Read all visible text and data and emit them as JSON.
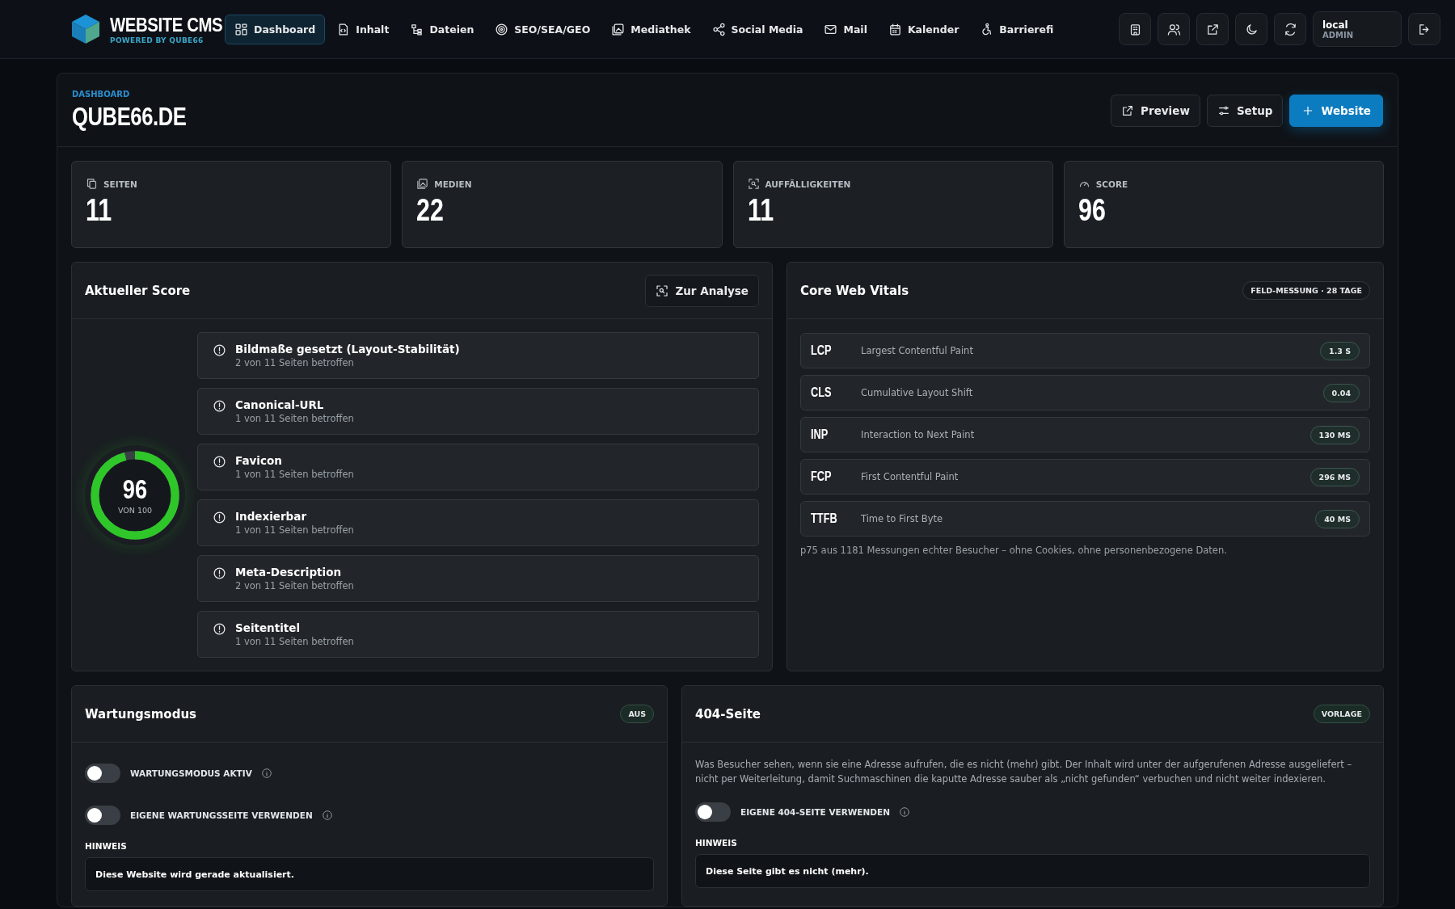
{
  "nav": {
    "logo_title": "WEBSITE CMS",
    "logo_subtitle": "POWERED BY QUBE66",
    "items": [
      {
        "label": "Dashboard",
        "selected": true
      },
      {
        "label": "Inhalt",
        "selected": false
      },
      {
        "label": "Dateien",
        "selected": false
      },
      {
        "label": "SEO/SEA/GEO",
        "selected": false
      },
      {
        "label": "Mediathek",
        "selected": false
      },
      {
        "label": "Social Media",
        "selected": false
      },
      {
        "label": "Mail",
        "selected": false
      },
      {
        "label": "Kalender",
        "selected": false
      },
      {
        "label": "Barrierefi",
        "selected": false
      }
    ],
    "user": {
      "name": "local",
      "role": "ADMIN"
    }
  },
  "header": {
    "breadcrumb": "DASHBOARD",
    "title": "QUBE66.DE",
    "buttons": [
      {
        "label": "Preview",
        "kind": "external"
      },
      {
        "label": "Setup",
        "kind": "settings"
      },
      {
        "label": "Website",
        "kind": "add"
      }
    ]
  },
  "stats": [
    {
      "label": "SEITEN",
      "value": "11"
    },
    {
      "label": "MEDIEN",
      "value": "22"
    },
    {
      "label": "AUFFÄLLIGKEITEN",
      "value": "11"
    },
    {
      "label": "SCORE",
      "value": "96"
    }
  ],
  "score_panel": {
    "title": "Aktueller Score",
    "button": "Zur Analyse",
    "score": "96",
    "caption": "VON 100",
    "level": 0.96,
    "issues": [
      {
        "title": "Bildmaße gesetzt (Layout-Stabilität)",
        "detail": "2 von 11 Seiten betroffen"
      },
      {
        "title": "Canonical-URL",
        "detail": "1 von 11 Seiten betroffen"
      },
      {
        "title": "Favicon",
        "detail": "1 von 11 Seiten betroffen"
      },
      {
        "title": "Indexierbar",
        "detail": "1 von 11 Seiten betroffen"
      },
      {
        "title": "Meta-Description",
        "detail": "2 von 11 Seiten betroffen"
      },
      {
        "title": "Seitentitel",
        "detail": "1 von 11 Seiten betroffen"
      }
    ]
  },
  "web_vitals": {
    "title": "Core Web Vitals",
    "badge": "FELD-MESSUNG · 28 TAGE",
    "metrics": [
      {
        "code": "LCP",
        "name": "Largest Contentful Paint",
        "value": "1.3 S"
      },
      {
        "code": "CLS",
        "name": "Cumulative Layout Shift",
        "value": "0.04"
      },
      {
        "code": "INP",
        "name": "Interaction to Next Paint",
        "value": "130 MS"
      },
      {
        "code": "FCP",
        "name": "First Contentful Paint",
        "value": "296 MS"
      },
      {
        "code": "TTFB",
        "name": "Time to First Byte",
        "value": "40 MS"
      }
    ],
    "footnote": "p75 aus 1181 Messungen echter Besucher – ohne Cookies, ohne personenbezogene Daten."
  },
  "maintenance": {
    "title": "Wartungsmodus",
    "badge": "AUS",
    "toggles": [
      {
        "label": "WARTUNGSMODUS AKTIV",
        "on": false
      },
      {
        "label": "EIGENE WARTUNGSSEITE VERWENDEN",
        "on": false
      }
    ],
    "hint": {
      "label": "HINWEIS",
      "value": "Diese Website wird gerade aktualisiert."
    }
  },
  "page_404": {
    "title": "404-Seite",
    "badge": "VORLAGE",
    "description": "Was Besucher sehen, wenn sie eine Adresse aufrufen, die es nicht (mehr) gibt. Der Inhalt wird unter der aufgerufenen Adresse ausgeliefert – nicht per Weiterleitung, damit Suchmaschinen die kaputte Adresse sauber als „nicht gefunden“ verbuchen und nicht weiter indexieren.",
    "toggles": [
      {
        "label": "EIGENE 404-SEITE VERWENDEN",
        "on": false
      }
    ],
    "hint": {
      "label": "HINWEIS",
      "value": "Diese Seite gibt es nicht (mehr)."
    }
  }
}
